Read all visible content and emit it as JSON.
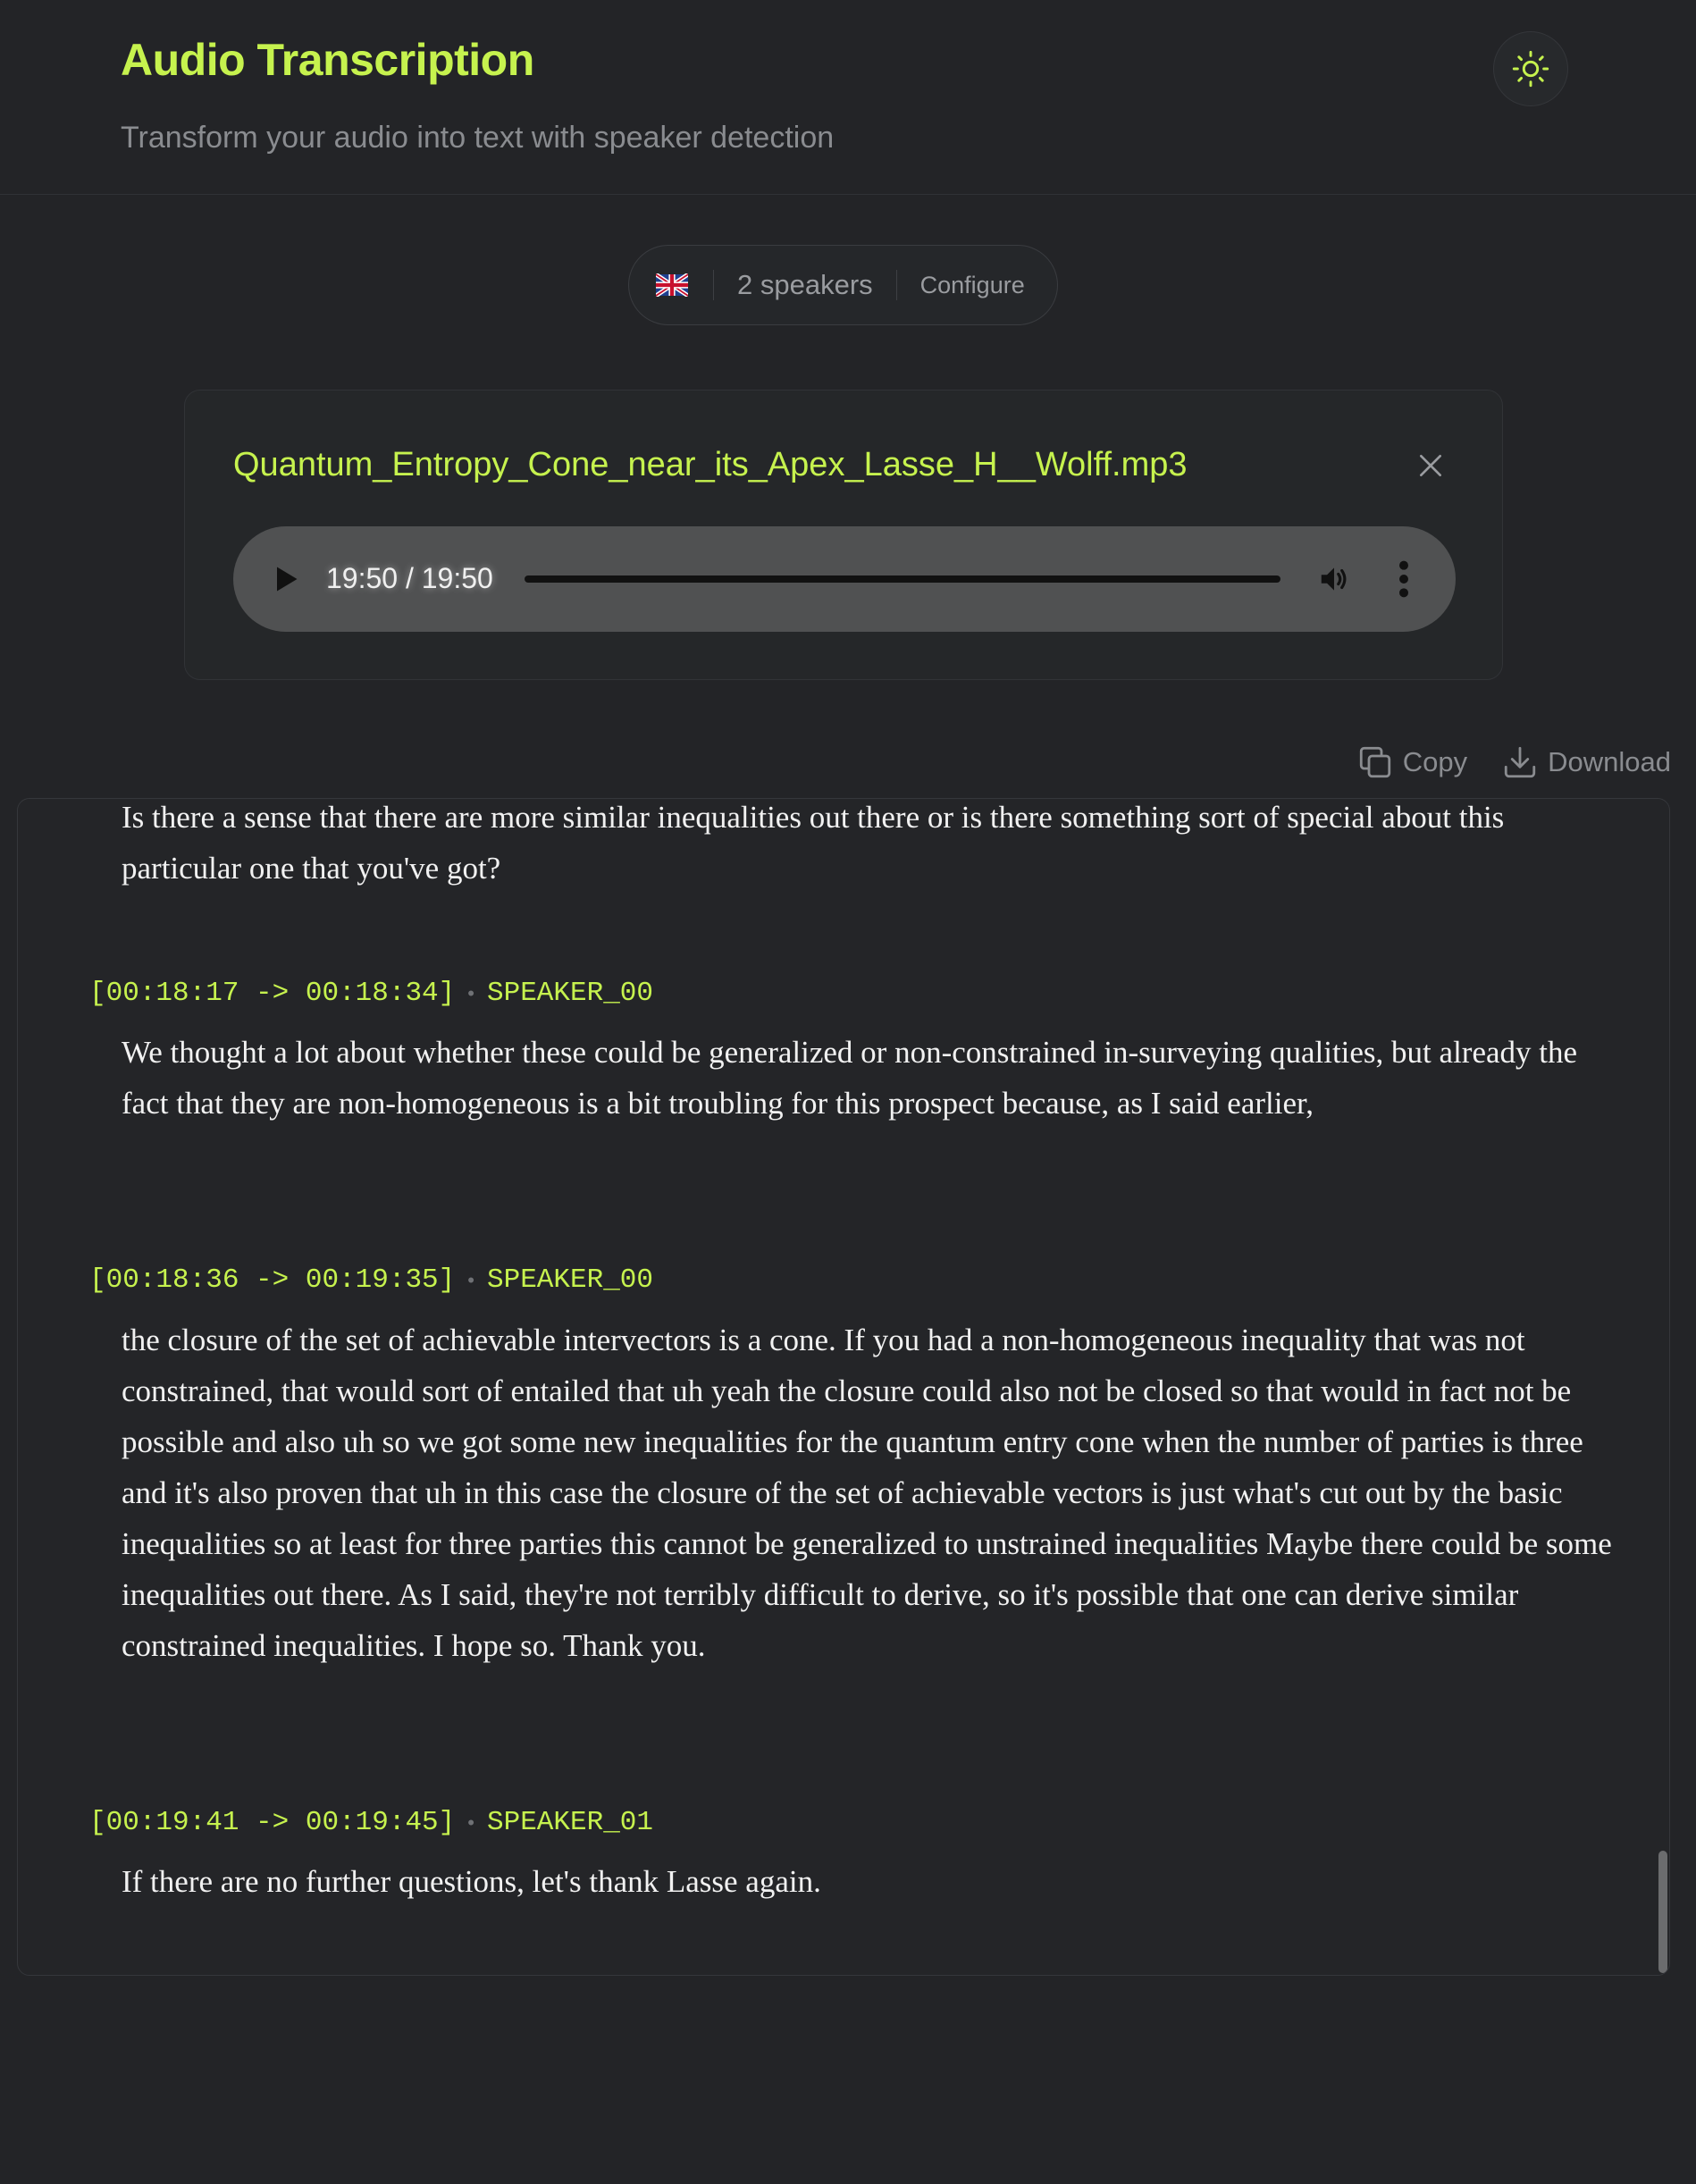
{
  "header": {
    "title": "Audio Transcription",
    "subtitle": "Transform your audio into text with speaker detection"
  },
  "theme_toggle": {
    "icon": "sun-icon"
  },
  "settings": {
    "language_flag": "uk-flag-icon",
    "speakers_label": "2 speakers",
    "configure_label": "Configure"
  },
  "file": {
    "name": "Quantum_Entropy_Cone_near_its_Apex_Lasse_H__Wolff.mp3",
    "player": {
      "time": "19:50 / 19:50",
      "progress": 1.0
    }
  },
  "actions": {
    "copy_label": "Copy",
    "download_label": "Download"
  },
  "transcript": {
    "partial_text": "Is there a sense that there are more similar inequalities out there or is there something sort of special about this particular one that you've got?",
    "segments": [
      {
        "timestamp": "[00:18:17 -> 00:18:34]",
        "speaker": "SPEAKER_00",
        "text": "We thought a lot about whether these could be generalized or non-constrained in-surveying qualities, but already the fact that they are non-homogeneous is a bit troubling for this prospect because, as I said earlier,"
      },
      {
        "timestamp": "[00:18:36 -> 00:19:35]",
        "speaker": "SPEAKER_00",
        "text": "the closure of the set of achievable intervectors is a cone. If you had a non-homogeneous inequality that was not constrained, that would sort of entailed that uh yeah the closure could also not be closed so that would in fact not be possible and also uh so we got some new inequalities for the quantum entry cone when the number of parties is three and it's also proven that uh in this case the closure of the set of achievable vectors is just what's cut out by the basic inequalities so at least for three parties this cannot be generalized to unstrained inequalities Maybe there could be some inequalities out there. As I said, they're not terribly difficult to derive, so it's possible that one can derive similar constrained inequalities. I hope so. Thank you."
      },
      {
        "timestamp": "[00:19:41 -> 00:19:45]",
        "speaker": "SPEAKER_01",
        "text": "If there are no further questions, let's thank Lasse again."
      }
    ]
  },
  "colors": {
    "accent": "#c6f24e",
    "background": "#232427"
  }
}
